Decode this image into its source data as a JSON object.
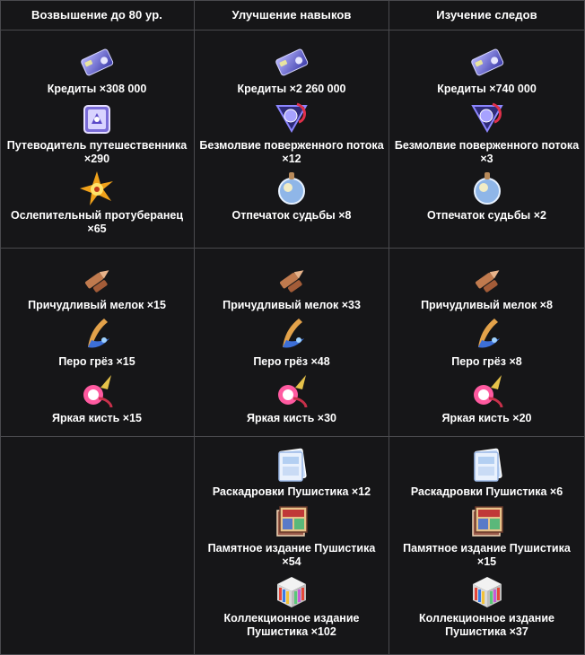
{
  "headers": [
    "Возвышение до 80 ур.",
    "Улучшение навыков",
    "Изучение следов"
  ],
  "rows": [
    [
      [
        {
          "icon": "credits-icon",
          "label": "Кредиты ×308 000"
        },
        {
          "icon": "travelers-guide-icon",
          "label": "Путеводитель путешественника ×290"
        },
        {
          "icon": "blinding-flare-icon",
          "label": "Ослепительный протуберанец ×65"
        }
      ],
      [
        {
          "icon": "credits-icon",
          "label": "Кредиты ×2 260 000"
        },
        {
          "icon": "fallen-stream-silence-icon",
          "label": "Безмолвие поверженного потока ×12"
        },
        {
          "icon": "destiny-imprint-icon",
          "label": "Отпечаток судьбы ×8"
        }
      ],
      [
        {
          "icon": "credits-icon",
          "label": "Кредиты ×740 000"
        },
        {
          "icon": "fallen-stream-silence-icon",
          "label": "Безмолвие поверженного потока ×3"
        },
        {
          "icon": "destiny-imprint-icon",
          "label": "Отпечаток судьбы ×2"
        }
      ]
    ],
    [
      [
        {
          "icon": "quirky-chalk-icon",
          "label": "Причудливый мелок ×15"
        },
        {
          "icon": "dream-quill-icon",
          "label": "Перо грёз ×15"
        },
        {
          "icon": "bright-brush-icon",
          "label": "Яркая кисть ×15"
        }
      ],
      [
        {
          "icon": "quirky-chalk-icon",
          "label": "Причудливый мелок ×33"
        },
        {
          "icon": "dream-quill-icon",
          "label": "Перо грёз ×48"
        },
        {
          "icon": "bright-brush-icon",
          "label": "Яркая кисть ×30"
        }
      ],
      [
        {
          "icon": "quirky-chalk-icon",
          "label": "Причудливый мелок ×8"
        },
        {
          "icon": "dream-quill-icon",
          "label": "Перо грёз ×8"
        },
        {
          "icon": "bright-brush-icon",
          "label": "Яркая кисть ×20"
        }
      ]
    ],
    [
      [],
      [
        {
          "icon": "fluffy-storyboards-icon",
          "label": "Раскадровки Пушистика ×12"
        },
        {
          "icon": "fluffy-memorial-edition-icon",
          "label": "Памятное издание Пушистика ×54"
        },
        {
          "icon": "fluffy-collector-edition-icon",
          "label": "Коллекционное издание Пушистика ×102"
        }
      ],
      [
        {
          "icon": "fluffy-storyboards-icon",
          "label": "Раскадровки Пушистика ×6"
        },
        {
          "icon": "fluffy-memorial-edition-icon",
          "label": "Памятное издание Пушистика ×15"
        },
        {
          "icon": "fluffy-collector-edition-icon",
          "label": "Коллекционное издание Пушистика ×37"
        }
      ]
    ]
  ],
  "colors": {
    "background": "#161618",
    "grid": "#4a4a4e",
    "text": "#ffffff"
  }
}
